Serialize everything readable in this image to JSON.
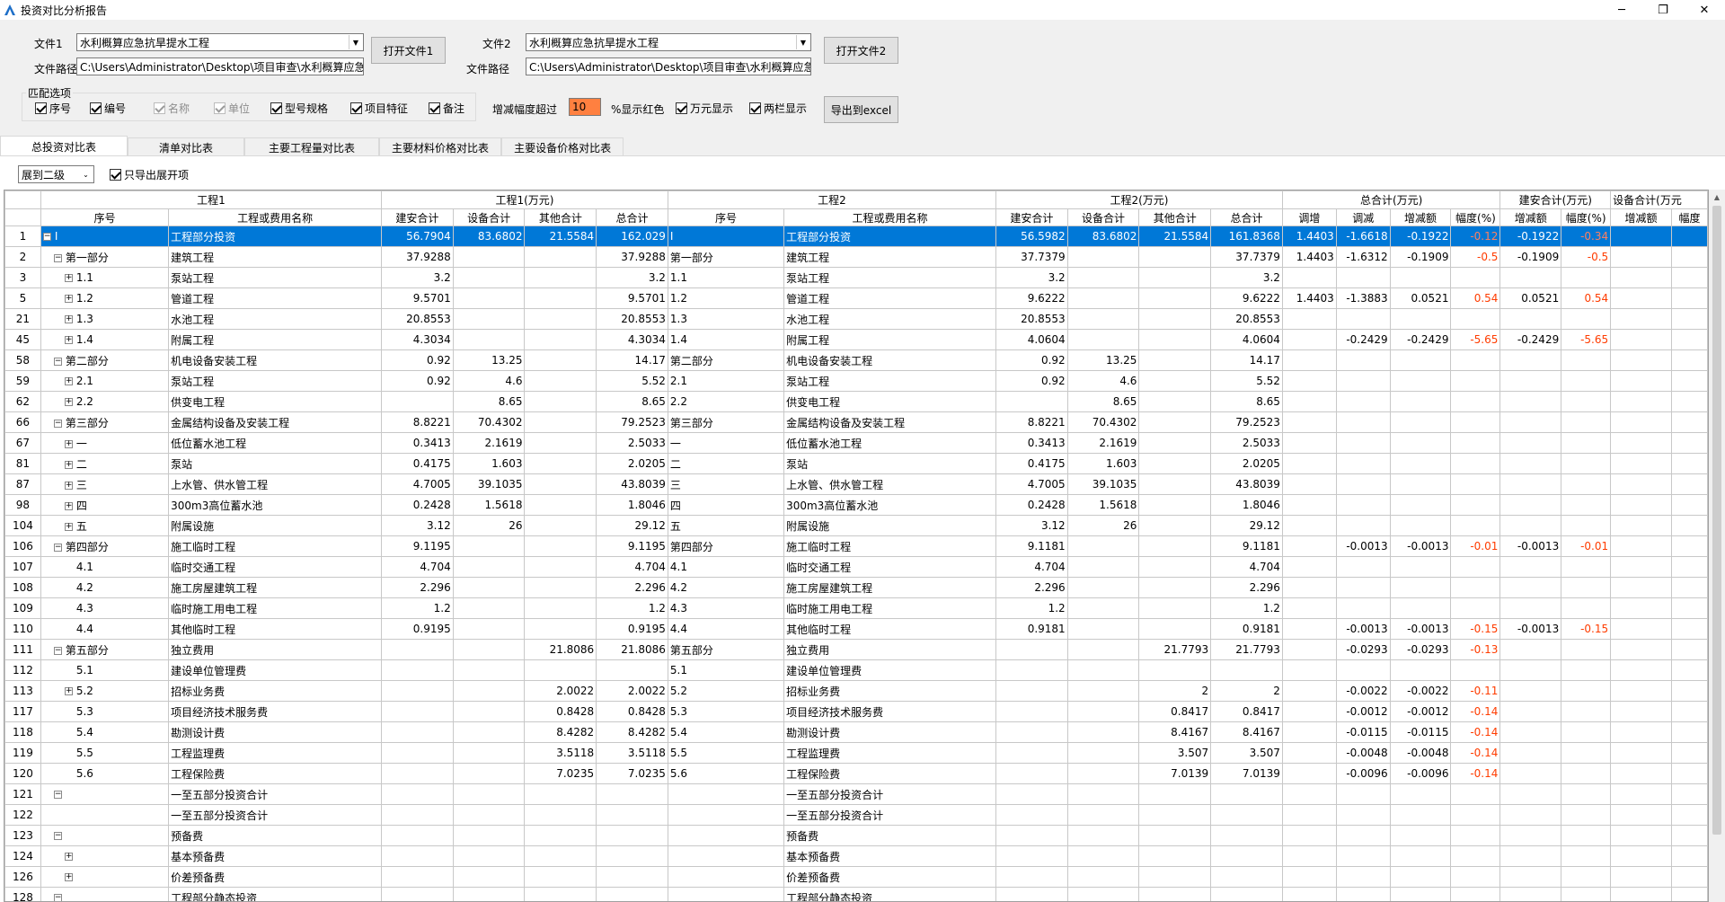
{
  "window": {
    "title": "投资对比分析报告",
    "minimize": "─",
    "maximize": "❐",
    "close": "✕"
  },
  "file1": {
    "label": "文件1",
    "value": "水利概算应急抗旱提水工程",
    "path_label": "文件路径",
    "path": "C:\\Users\\Administrator\\Desktop\\项目审查\\水利概算应急抗",
    "open_btn": "打开文件1"
  },
  "file2": {
    "label": "文件2",
    "value": "水利概算应急抗旱提水工程",
    "path_label": "文件路径",
    "path": "C:\\Users\\Administrator\\Desktop\\项目审查\\水利概算应急抗",
    "open_btn": "打开文件2"
  },
  "options": {
    "group_label": "匹配选项",
    "items": [
      {
        "label": "序号",
        "checked": true,
        "enabled": true
      },
      {
        "label": "编号",
        "checked": true,
        "enabled": true
      },
      {
        "label": "名称",
        "checked": true,
        "enabled": false
      },
      {
        "label": "单位",
        "checked": true,
        "enabled": false
      },
      {
        "label": "型号规格",
        "checked": true,
        "enabled": true
      },
      {
        "label": "项目特征",
        "checked": true,
        "enabled": true
      },
      {
        "label": "备注",
        "checked": true,
        "enabled": true
      }
    ],
    "threshold_label": "增减幅度超过",
    "threshold_value": "10",
    "red_label": "%显示红色",
    "wan_label": "万元显示",
    "two_col_label": "两栏显示",
    "export_btn": "导出到excel"
  },
  "tabs": [
    "总投资对比表",
    "清单对比表",
    "主要工程量对比表",
    "主要材料价格对比表",
    "主要设备价格对比表"
  ],
  "expand": {
    "value": "展到二级",
    "only_label": "只导出展开项"
  },
  "header_groups": {
    "g1": "工程1",
    "g1m": "工程1(万元)",
    "g2": "工程2",
    "g2m": "工程2(万元)",
    "tot": "总合计(万元)",
    "ja": "建安合计(万元)",
    "sb": "设备合计(万元"
  },
  "header_cols": {
    "c1": "序号",
    "c2": "工程或费用名称",
    "c3": "建安合计",
    "c4": "设备合计",
    "c5": "其他合计",
    "c6": "总合计",
    "c7": "序号",
    "c8": "工程或费用名称",
    "c9": "建安合计",
    "c10": "设备合计",
    "c11": "其他合计",
    "c12": "总合计",
    "c13": "调增",
    "c14": "调减",
    "c15": "增减额",
    "c16": "幅度(%)",
    "c17": "增减额",
    "c18": "幅度(%)",
    "c19": "增减额",
    "c20": "幅度"
  },
  "rows": [
    {
      "n": "1",
      "t": "minus",
      "d": 0,
      "s1": "I",
      "nm1": "工程部分投资",
      "a1": "56.7904",
      "b1": "83.6802",
      "o1": "21.5584",
      "t1": "162.029",
      "s2": "I",
      "nm2": "工程部分投资",
      "a2": "56.5982",
      "b2": "83.6802",
      "o2": "21.5584",
      "t2": "161.8368",
      "up": "1.4403",
      "dn": "-1.6618",
      "dd": "-0.1922",
      "dp": "-0.12",
      "ja": "-0.1922",
      "jp": "-0.34",
      "sel": true
    },
    {
      "n": "2",
      "t": "minus",
      "d": 1,
      "s1": "第一部分",
      "nm1": " 建筑工程",
      "a1": "37.9288",
      "b1": "",
      "o1": "",
      "t1": "37.9288",
      "s2": "第一部分",
      "nm2": " 建筑工程",
      "a2": "37.7379",
      "b2": "",
      "o2": "",
      "t2": "37.7379",
      "up": "1.4403",
      "dn": "-1.6312",
      "dd": "-0.1909",
      "dp": "-0.5",
      "ja": "-0.1909",
      "jp": "-0.5"
    },
    {
      "n": "3",
      "t": "plus",
      "d": 2,
      "s1": "1.1",
      "nm1": "泵站工程",
      "a1": "3.2",
      "b1": "",
      "o1": "",
      "t1": "3.2",
      "s2": "1.1",
      "nm2": "泵站工程",
      "a2": "3.2",
      "b2": "",
      "o2": "",
      "t2": "3.2",
      "up": "",
      "dn": "",
      "dd": "",
      "dp": "",
      "ja": "",
      "jp": ""
    },
    {
      "n": "5",
      "t": "plus",
      "d": 2,
      "s1": "1.2",
      "nm1": "管道工程",
      "a1": "9.5701",
      "b1": "",
      "o1": "",
      "t1": "9.5701",
      "s2": "1.2",
      "nm2": "管道工程",
      "a2": "9.6222",
      "b2": "",
      "o2": "",
      "t2": "9.6222",
      "up": "1.4403",
      "dn": "-1.3883",
      "dd": "0.0521",
      "dp": "0.54",
      "ja": "0.0521",
      "jp": "0.54"
    },
    {
      "n": "21",
      "t": "plus",
      "d": 2,
      "s1": "1.3",
      "nm1": "水池工程",
      "a1": "20.8553",
      "b1": "",
      "o1": "",
      "t1": "20.8553",
      "s2": "1.3",
      "nm2": "水池工程",
      "a2": "20.8553",
      "b2": "",
      "o2": "",
      "t2": "20.8553",
      "up": "",
      "dn": "",
      "dd": "",
      "dp": "",
      "ja": "",
      "jp": ""
    },
    {
      "n": "45",
      "t": "plus",
      "d": 2,
      "s1": "1.4",
      "nm1": "附属工程",
      "a1": "4.3034",
      "b1": "",
      "o1": "",
      "t1": "4.3034",
      "s2": "1.4",
      "nm2": "附属工程",
      "a2": "4.0604",
      "b2": "",
      "o2": "",
      "t2": "4.0604",
      "up": "",
      "dn": "-0.2429",
      "dd": "-0.2429",
      "dp": "-5.65",
      "ja": "-0.2429",
      "jp": "-5.65"
    },
    {
      "n": "58",
      "t": "minus",
      "d": 1,
      "s1": "第二部分",
      "nm1": " 机电设备安装工程",
      "a1": "0.92",
      "b1": "13.25",
      "o1": "",
      "t1": "14.17",
      "s2": "第二部分",
      "nm2": " 机电设备安装工程",
      "a2": "0.92",
      "b2": "13.25",
      "o2": "",
      "t2": "14.17",
      "up": "",
      "dn": "",
      "dd": "",
      "dp": "",
      "ja": "",
      "jp": ""
    },
    {
      "n": "59",
      "t": "plus",
      "d": 2,
      "s1": "2.1",
      "nm1": "泵站工程",
      "a1": "0.92",
      "b1": "4.6",
      "o1": "",
      "t1": "5.52",
      "s2": "2.1",
      "nm2": "泵站工程",
      "a2": "0.92",
      "b2": "4.6",
      "o2": "",
      "t2": "5.52",
      "up": "",
      "dn": "",
      "dd": "",
      "dp": "",
      "ja": "",
      "jp": ""
    },
    {
      "n": "62",
      "t": "plus",
      "d": 2,
      "s1": "2.2",
      "nm1": "供变电工程",
      "a1": "",
      "b1": "8.65",
      "o1": "",
      "t1": "8.65",
      "s2": "2.2",
      "nm2": "供变电工程",
      "a2": "",
      "b2": "8.65",
      "o2": "",
      "t2": "8.65",
      "up": "",
      "dn": "",
      "dd": "",
      "dp": "",
      "ja": "",
      "jp": ""
    },
    {
      "n": "66",
      "t": "minus",
      "d": 1,
      "s1": "第三部分",
      "nm1": " 金属结构设备及安装工程",
      "a1": "8.8221",
      "b1": "70.4302",
      "o1": "",
      "t1": "79.2523",
      "s2": "第三部分",
      "nm2": " 金属结构设备及安装工程",
      "a2": "8.8221",
      "b2": "70.4302",
      "o2": "",
      "t2": "79.2523",
      "up": "",
      "dn": "",
      "dd": "",
      "dp": "",
      "ja": "",
      "jp": ""
    },
    {
      "n": "67",
      "t": "plus",
      "d": 2,
      "s1": "一",
      "nm1": "低位蓄水池工程",
      "a1": "0.3413",
      "b1": "2.1619",
      "o1": "",
      "t1": "2.5033",
      "s2": "一",
      "nm2": "低位蓄水池工程",
      "a2": "0.3413",
      "b2": "2.1619",
      "o2": "",
      "t2": "2.5033",
      "up": "",
      "dn": "",
      "dd": "",
      "dp": "",
      "ja": "",
      "jp": ""
    },
    {
      "n": "81",
      "t": "plus",
      "d": 2,
      "s1": "二",
      "nm1": "泵站",
      "a1": "0.4175",
      "b1": "1.603",
      "o1": "",
      "t1": "2.0205",
      "s2": "二",
      "nm2": "泵站",
      "a2": "0.4175",
      "b2": "1.603",
      "o2": "",
      "t2": "2.0205",
      "up": "",
      "dn": "",
      "dd": "",
      "dp": "",
      "ja": "",
      "jp": ""
    },
    {
      "n": "87",
      "t": "plus",
      "d": 2,
      "s1": "三",
      "nm1": "上水管、供水管工程",
      "a1": "4.7005",
      "b1": "39.1035",
      "o1": "",
      "t1": "43.8039",
      "s2": "三",
      "nm2": "上水管、供水管工程",
      "a2": "4.7005",
      "b2": "39.1035",
      "o2": "",
      "t2": "43.8039",
      "up": "",
      "dn": "",
      "dd": "",
      "dp": "",
      "ja": "",
      "jp": ""
    },
    {
      "n": "98",
      "t": "plus",
      "d": 2,
      "s1": "四",
      "nm1": "300m3高位蓄水池",
      "a1": "0.2428",
      "b1": "1.5618",
      "o1": "",
      "t1": "1.8046",
      "s2": "四",
      "nm2": "300m3高位蓄水池",
      "a2": "0.2428",
      "b2": "1.5618",
      "o2": "",
      "t2": "1.8046",
      "up": "",
      "dn": "",
      "dd": "",
      "dp": "",
      "ja": "",
      "jp": ""
    },
    {
      "n": "104",
      "t": "plus",
      "d": 2,
      "s1": "五",
      "nm1": "附属设施",
      "a1": "3.12",
      "b1": "26",
      "o1": "",
      "t1": "29.12",
      "s2": "五",
      "nm2": "附属设施",
      "a2": "3.12",
      "b2": "26",
      "o2": "",
      "t2": "29.12",
      "up": "",
      "dn": "",
      "dd": "",
      "dp": "",
      "ja": "",
      "jp": ""
    },
    {
      "n": "106",
      "t": "minus",
      "d": 1,
      "s1": "第四部分",
      "nm1": " 施工临时工程",
      "a1": "9.1195",
      "b1": "",
      "o1": "",
      "t1": "9.1195",
      "s2": "第四部分",
      "nm2": " 施工临时工程",
      "a2": "9.1181",
      "b2": "",
      "o2": "",
      "t2": "9.1181",
      "up": "",
      "dn": "-0.0013",
      "dd": "-0.0013",
      "dp": "-0.01",
      "ja": "-0.0013",
      "jp": "-0.01"
    },
    {
      "n": "107",
      "t": "none",
      "d": 2,
      "s1": "4.1",
      "nm1": "临时交通工程",
      "a1": "4.704",
      "b1": "",
      "o1": "",
      "t1": "4.704",
      "s2": "4.1",
      "nm2": "临时交通工程",
      "a2": "4.704",
      "b2": "",
      "o2": "",
      "t2": "4.704",
      "up": "",
      "dn": "",
      "dd": "",
      "dp": "",
      "ja": "",
      "jp": ""
    },
    {
      "n": "108",
      "t": "none",
      "d": 2,
      "s1": "4.2",
      "nm1": "施工房屋建筑工程",
      "a1": "2.296",
      "b1": "",
      "o1": "",
      "t1": "2.296",
      "s2": "4.2",
      "nm2": "施工房屋建筑工程",
      "a2": "2.296",
      "b2": "",
      "o2": "",
      "t2": "2.296",
      "up": "",
      "dn": "",
      "dd": "",
      "dp": "",
      "ja": "",
      "jp": ""
    },
    {
      "n": "109",
      "t": "none",
      "d": 2,
      "s1": "4.3",
      "nm1": "临时施工用电工程",
      "a1": "1.2",
      "b1": "",
      "o1": "",
      "t1": "1.2",
      "s2": "4.3",
      "nm2": "临时施工用电工程",
      "a2": "1.2",
      "b2": "",
      "o2": "",
      "t2": "1.2",
      "up": "",
      "dn": "",
      "dd": "",
      "dp": "",
      "ja": "",
      "jp": ""
    },
    {
      "n": "110",
      "t": "none",
      "d": 2,
      "s1": "4.4",
      "nm1": "其他临时工程",
      "a1": "0.9195",
      "b1": "",
      "o1": "",
      "t1": "0.9195",
      "s2": "4.4",
      "nm2": "其他临时工程",
      "a2": "0.9181",
      "b2": "",
      "o2": "",
      "t2": "0.9181",
      "up": "",
      "dn": "-0.0013",
      "dd": "-0.0013",
      "dp": "-0.15",
      "ja": "-0.0013",
      "jp": "-0.15"
    },
    {
      "n": "111",
      "t": "minus",
      "d": 1,
      "s1": "第五部分",
      "nm1": " 独立费用",
      "a1": "",
      "b1": "",
      "o1": "21.8086",
      "t1": "21.8086",
      "s2": "第五部分",
      "nm2": " 独立费用",
      "a2": "",
      "b2": "",
      "o2": "21.7793",
      "t2": "21.7793",
      "up": "",
      "dn": "-0.0293",
      "dd": "-0.0293",
      "dp": "-0.13",
      "ja": "",
      "jp": ""
    },
    {
      "n": "112",
      "t": "none",
      "d": 2,
      "s1": "5.1",
      "nm1": "建设单位管理费",
      "a1": "",
      "b1": "",
      "o1": "",
      "t1": "",
      "s2": "5.1",
      "nm2": "建设单位管理费",
      "a2": "",
      "b2": "",
      "o2": "",
      "t2": "",
      "up": "",
      "dn": "",
      "dd": "",
      "dp": "",
      "ja": "",
      "jp": ""
    },
    {
      "n": "113",
      "t": "plus",
      "d": 2,
      "s1": "5.2",
      "nm1": "招标业务费",
      "a1": "",
      "b1": "",
      "o1": "2.0022",
      "t1": "2.0022",
      "s2": "5.2",
      "nm2": "招标业务费",
      "a2": "",
      "b2": "",
      "o2": "2",
      "t2": "2",
      "up": "",
      "dn": "-0.0022",
      "dd": "-0.0022",
      "dp": "-0.11",
      "ja": "",
      "jp": ""
    },
    {
      "n": "117",
      "t": "none",
      "d": 2,
      "s1": "5.3",
      "nm1": "项目经济技术服务费",
      "a1": "",
      "b1": "",
      "o1": "0.8428",
      "t1": "0.8428",
      "s2": "5.3",
      "nm2": "项目经济技术服务费",
      "a2": "",
      "b2": "",
      "o2": "0.8417",
      "t2": "0.8417",
      "up": "",
      "dn": "-0.0012",
      "dd": "-0.0012",
      "dp": "-0.14",
      "ja": "",
      "jp": ""
    },
    {
      "n": "118",
      "t": "none",
      "d": 2,
      "s1": "5.4",
      "nm1": "勘测设计费",
      "a1": "",
      "b1": "",
      "o1": "8.4282",
      "t1": "8.4282",
      "s2": "5.4",
      "nm2": "勘测设计费",
      "a2": "",
      "b2": "",
      "o2": "8.4167",
      "t2": "8.4167",
      "up": "",
      "dn": "-0.0115",
      "dd": "-0.0115",
      "dp": "-0.14",
      "ja": "",
      "jp": ""
    },
    {
      "n": "119",
      "t": "none",
      "d": 2,
      "s1": "5.5",
      "nm1": "工程监理费",
      "a1": "",
      "b1": "",
      "o1": "3.5118",
      "t1": "3.5118",
      "s2": "5.5",
      "nm2": "工程监理费",
      "a2": "",
      "b2": "",
      "o2": "3.507",
      "t2": "3.507",
      "up": "",
      "dn": "-0.0048",
      "dd": "-0.0048",
      "dp": "-0.14",
      "ja": "",
      "jp": ""
    },
    {
      "n": "120",
      "t": "none",
      "d": 2,
      "s1": "5.6",
      "nm1": "工程保险费",
      "a1": "",
      "b1": "",
      "o1": "7.0235",
      "t1": "7.0235",
      "s2": "5.6",
      "nm2": "工程保险费",
      "a2": "",
      "b2": "",
      "o2": "7.0139",
      "t2": "7.0139",
      "up": "",
      "dn": "-0.0096",
      "dd": "-0.0096",
      "dp": "-0.14",
      "ja": "",
      "jp": ""
    },
    {
      "n": "121",
      "t": "minus",
      "d": 1,
      "s1": "",
      "nm1": "一至五部分投资合计",
      "a1": "",
      "b1": "",
      "o1": "",
      "t1": "",
      "s2": "",
      "nm2": "一至五部分投资合计",
      "a2": "",
      "b2": "",
      "o2": "",
      "t2": "",
      "up": "",
      "dn": "",
      "dd": "",
      "dp": "",
      "ja": "",
      "jp": ""
    },
    {
      "n": "122",
      "t": "none",
      "d": 2,
      "s1": "",
      "nm1": "一至五部分投资合计",
      "a1": "",
      "b1": "",
      "o1": "",
      "t1": "",
      "s2": "",
      "nm2": "一至五部分投资合计",
      "a2": "",
      "b2": "",
      "o2": "",
      "t2": "",
      "up": "",
      "dn": "",
      "dd": "",
      "dp": "",
      "ja": "",
      "jp": ""
    },
    {
      "n": "123",
      "t": "minus",
      "d": 1,
      "s1": "",
      "nm1": "预备费",
      "a1": "",
      "b1": "",
      "o1": "",
      "t1": "",
      "s2": "",
      "nm2": "预备费",
      "a2": "",
      "b2": "",
      "o2": "",
      "t2": "",
      "up": "",
      "dn": "",
      "dd": "",
      "dp": "",
      "ja": "",
      "jp": ""
    },
    {
      "n": "124",
      "t": "plus",
      "d": 2,
      "s1": "",
      "nm1": "基本预备费",
      "a1": "",
      "b1": "",
      "o1": "",
      "t1": "",
      "s2": "",
      "nm2": "基本预备费",
      "a2": "",
      "b2": "",
      "o2": "",
      "t2": "",
      "up": "",
      "dn": "",
      "dd": "",
      "dp": "",
      "ja": "",
      "jp": ""
    },
    {
      "n": "126",
      "t": "plus",
      "d": 2,
      "s1": "",
      "nm1": "价差预备费",
      "a1": "",
      "b1": "",
      "o1": "",
      "t1": "",
      "s2": "",
      "nm2": "价差预备费",
      "a2": "",
      "b2": "",
      "o2": "",
      "t2": "",
      "up": "",
      "dn": "",
      "dd": "",
      "dp": "",
      "ja": "",
      "jp": ""
    },
    {
      "n": "128",
      "t": "minus",
      "d": 1,
      "s1": "",
      "nm1": "工程部分静态投资",
      "a1": "",
      "b1": "",
      "o1": "",
      "t1": "",
      "s2": "",
      "nm2": "工程部分静态投资",
      "a2": "",
      "b2": "",
      "o2": "",
      "t2": "",
      "up": "",
      "dn": "",
      "dd": "",
      "dp": "",
      "ja": "",
      "jp": ""
    }
  ],
  "colors": {
    "selection": "#0078d7",
    "red_text": "#ff3c00",
    "threshold_bg": "#ff8040"
  }
}
